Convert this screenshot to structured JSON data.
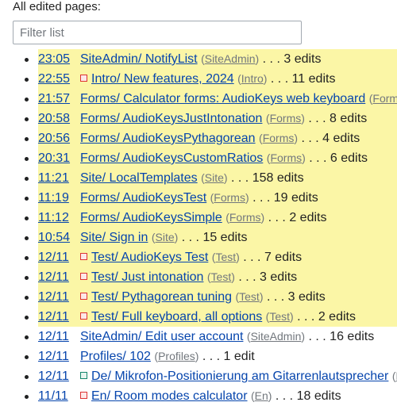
{
  "heading": "All edited pages:",
  "filter": {
    "placeholder": "Filter list"
  },
  "rows": [
    {
      "time": "23:05",
      "mark": "",
      "title": "SiteAdmin/ NotifyList",
      "group": "SiteAdmin",
      "edits": "3 edits",
      "hl": true
    },
    {
      "time": "22:55",
      "mark": "red",
      "title": "Intro/ New features, 2024",
      "group": "Intro",
      "edits": "11 edits",
      "hl": true
    },
    {
      "time": "21:57",
      "mark": "",
      "title": "Forms/ Calculator forms: AudioKeys web keyboard",
      "group": "Forms",
      "edits": "",
      "hl": true
    },
    {
      "time": "20:58",
      "mark": "",
      "title": "Forms/ AudioKeysJustIntonation",
      "group": "Forms",
      "edits": "8 edits",
      "hl": true
    },
    {
      "time": "20:56",
      "mark": "",
      "title": "Forms/ AudioKeysPythagorean",
      "group": "Forms",
      "edits": "4 edits",
      "hl": true
    },
    {
      "time": "20:31",
      "mark": "",
      "title": "Forms/ AudioKeysCustomRatios",
      "group": "Forms",
      "edits": "6 edits",
      "hl": true
    },
    {
      "time": "11:21",
      "mark": "",
      "title": "Site/ LocalTemplates",
      "group": "Site",
      "edits": "158 edits",
      "hl": true
    },
    {
      "time": "11:19",
      "mark": "",
      "title": "Forms/ AudioKeysTest",
      "group": "Forms",
      "edits": "19 edits",
      "hl": true
    },
    {
      "time": "11:12",
      "mark": "",
      "title": "Forms/ AudioKeysSimple",
      "group": "Forms",
      "edits": "2 edits",
      "hl": true
    },
    {
      "time": "10:54",
      "mark": "",
      "title": "Site/ Sign in",
      "group": "Site",
      "edits": "15 edits",
      "hl": true
    },
    {
      "time": "12/11",
      "mark": "red",
      "title": "Test/ AudioKeys Test",
      "group": "Test",
      "edits": "7 edits",
      "hl": true
    },
    {
      "time": "12/11",
      "mark": "red",
      "title": "Test/ Just intonation",
      "group": "Test",
      "edits": "3 edits",
      "hl": true
    },
    {
      "time": "12/11",
      "mark": "red",
      "title": "Test/ Pythagorean tuning",
      "group": "Test",
      "edits": "3 edits",
      "hl": true
    },
    {
      "time": "12/11",
      "mark": "red",
      "title": "Test/ Full keyboard, all options",
      "group": "Test",
      "edits": "2 edits",
      "hl": true
    },
    {
      "time": "12/11",
      "mark": "",
      "title": "SiteAdmin/ Edit user account",
      "group": "SiteAdmin",
      "edits": "16 edits",
      "hl": false
    },
    {
      "time": "12/11",
      "mark": "",
      "title": "Profiles/ 102",
      "group": "Profiles",
      "edits": "1 edit",
      "hl": false
    },
    {
      "time": "12/11",
      "mark": "green",
      "title": "De/ Mikrofon-Positionierung am Gitarrenlautsprecher",
      "group": "De",
      "edits": "",
      "hl": false
    },
    {
      "time": "11/11",
      "mark": "red",
      "title": "En/ Room modes calculator",
      "group": "En",
      "edits": "18 edits",
      "hl": false
    }
  ],
  "colors": {
    "highlight": "#fbf6a6",
    "link": "#0645ad",
    "mark_red": "#d33",
    "mark_green": "#14866d"
  }
}
